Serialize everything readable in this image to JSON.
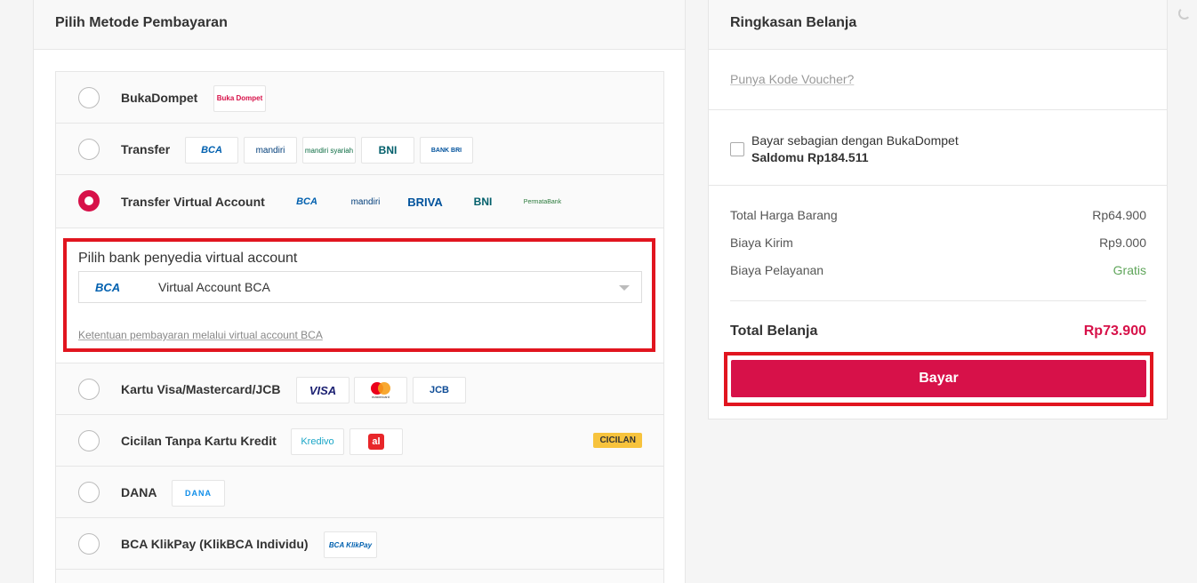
{
  "left": {
    "title": "Pilih Metode Pembayaran",
    "methods": [
      {
        "label": "BukaDompet",
        "logos": [
          "Buka Dompet"
        ]
      },
      {
        "label": "Transfer",
        "logos": [
          "BCA",
          "mandiri",
          "mandiri syariah",
          "BNI",
          "BANK BRI"
        ]
      },
      {
        "label": "Transfer Virtual Account",
        "logos": [
          "BCA",
          "mandiri",
          "BRIVA",
          "BNI",
          "PermataBank"
        ]
      },
      {
        "label": "Kartu Visa/Mastercard/JCB",
        "logos": [
          "VISA",
          "mastercard",
          "JCB"
        ]
      },
      {
        "label": "Cicilan Tanpa Kartu Kredit",
        "logos": [
          "Kredivo",
          "al"
        ],
        "badge": "CICILAN"
      },
      {
        "label": "DANA",
        "logos": [
          "DANA"
        ]
      },
      {
        "label": "BCA KlikPay (KlikBCA Individu)",
        "logos": [
          "BCA KlikPay"
        ]
      }
    ],
    "va": {
      "title": "Pilih bank penyedia virtual account",
      "selected_logo": "BCA",
      "selected_text": "Virtual Account BCA",
      "link": "Ketentuan pembayaran melalui virtual account BCA"
    }
  },
  "right": {
    "title": "Ringkasan Belanja",
    "voucher": "Punya Kode Voucher?",
    "partial_label": "Bayar sebagian dengan BukaDompet",
    "balance": "Saldomu Rp184.511",
    "rows": [
      {
        "label": "Total Harga Barang",
        "value": "Rp64.900"
      },
      {
        "label": "Biaya Kirim",
        "value": "Rp9.000"
      },
      {
        "label": "Biaya Pelayanan",
        "value": "Gratis"
      }
    ],
    "total_label": "Total Belanja",
    "total_value": "Rp73.900",
    "pay_button": "Bayar"
  },
  "colors": {
    "brand": "#d71149",
    "highlight": "#e1151f",
    "green": "#5fa55a",
    "badge": "#f7c33d"
  }
}
